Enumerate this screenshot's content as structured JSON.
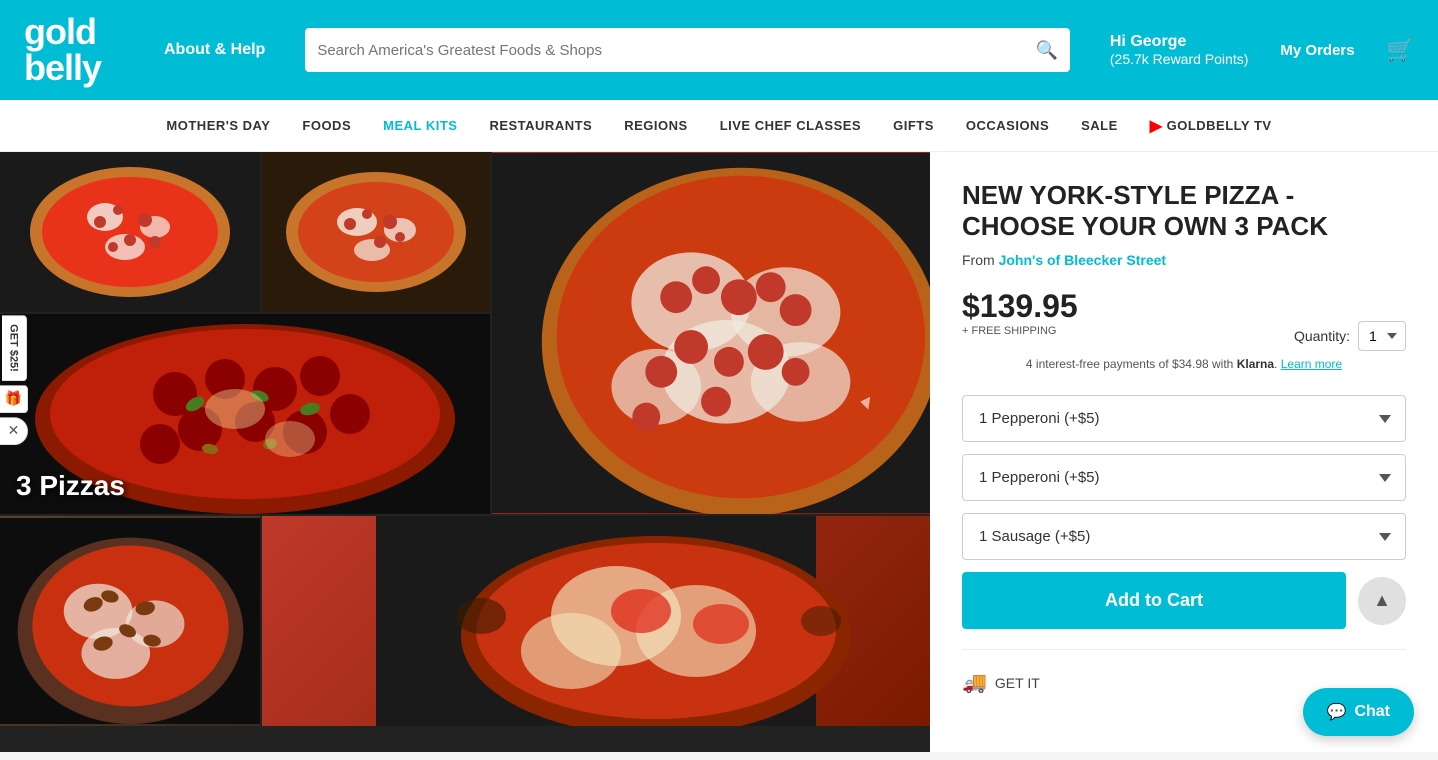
{
  "header": {
    "logo_line1": "GOLD",
    "logo_line2": "BeLLy",
    "about_help": "About & Help",
    "search_placeholder": "Search America's Greatest Foods & Shops",
    "greeting_hi": "Hi George",
    "reward_points": "(25.7k Reward Points)",
    "my_orders": "My Orders"
  },
  "nav": {
    "items": [
      {
        "label": "MOTHER'S DAY",
        "key": "mothers-day"
      },
      {
        "label": "FOODS",
        "key": "foods"
      },
      {
        "label": "MEAL KITS",
        "key": "meal-kits",
        "active": true
      },
      {
        "label": "RESTAURANTS",
        "key": "restaurants"
      },
      {
        "label": "REGIONS",
        "key": "regions"
      },
      {
        "label": "LIVE CHEF CLASSES",
        "key": "live-chef-classes"
      },
      {
        "label": "GIFTS",
        "key": "gifts"
      },
      {
        "label": "OCCASIONS",
        "key": "occasions"
      },
      {
        "label": "SALE",
        "key": "sale"
      },
      {
        "label": "GOLDBELLY TV",
        "key": "goldbelly-tv"
      }
    ]
  },
  "product": {
    "title": "NEW YORK-STYLE PIZZA - CHOOSE YOUR OWN 3 PACK",
    "from_label": "From",
    "shop_name": "John's of Bleecker Street",
    "price": "$139.95",
    "free_shipping": "+ FREE SHIPPING",
    "quantity_label": "Quantity:",
    "quantity_value": "1",
    "klarna_text": "4 interest-free payments of $34.98 with",
    "klarna_brand": "Klarna",
    "klarna_link": "Learn more",
    "pizza_label": "3 Pizzas",
    "dropdown1_value": "1 Pepperoni (+$5)",
    "dropdown2_value": "1 Pepperoni (+$5)",
    "dropdown3_value": "1 Sausage (+$5)",
    "add_to_cart_label": "Add to Cart",
    "get_it_label": "GET IT"
  },
  "sidebar": {
    "referral_label": "GET $25!",
    "close_icon": "✕"
  },
  "chat": {
    "label": "Chat",
    "icon": "💬"
  },
  "colors": {
    "accent": "#00bcd4",
    "header_bg": "#00bcd4",
    "nav_bg": "#ffffff",
    "button_bg": "#00bcd4"
  }
}
